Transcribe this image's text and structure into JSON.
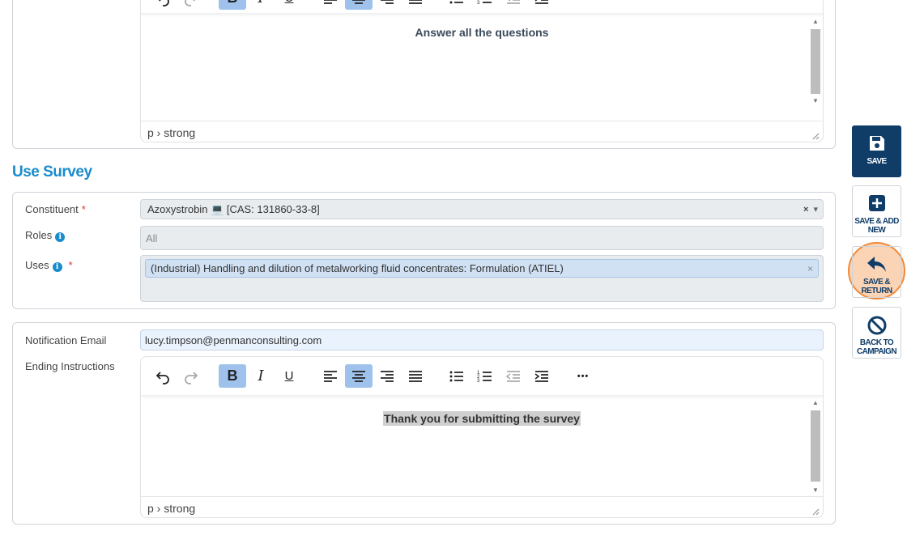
{
  "intro_editor": {
    "content": "Answer all the questions",
    "path": "p › strong"
  },
  "use_survey": {
    "title": "Use Survey",
    "constituent": {
      "label": "Constituent",
      "required_mark": "*",
      "value": "Azoxystrobin 💻 [CAS: 131860-33-8]",
      "clear": "×",
      "caret": "▾"
    },
    "roles": {
      "label": "Roles",
      "info": "i",
      "placeholder": "All"
    },
    "uses": {
      "label": "Uses",
      "info": "i",
      "required_mark": "*",
      "tag": "(Industrial) Handling and dilution of metalworking fluid concentrates: Formulation (ATIEL)",
      "tag_remove": "×"
    }
  },
  "notification": {
    "email_label": "Notification Email",
    "email_value": "lucy.timpson@penmanconsulting.com",
    "ending_label": "Ending Instructions",
    "ending_content": "Thank you for submitting the survey",
    "path": "p › strong"
  },
  "toolbar": {
    "more": "•••"
  },
  "actions": {
    "save": "SAVE",
    "save_add": "SAVE & ADD NEW",
    "save_return": "SAVE & RETURN",
    "back": "BACK TO CAMPAIGN"
  },
  "colors": {
    "accent": "#1a8ccc",
    "primary": "#0f3d68",
    "active_tool": "#9fc2ec",
    "highlight": "#f08a3a",
    "required": "#d9342b"
  }
}
